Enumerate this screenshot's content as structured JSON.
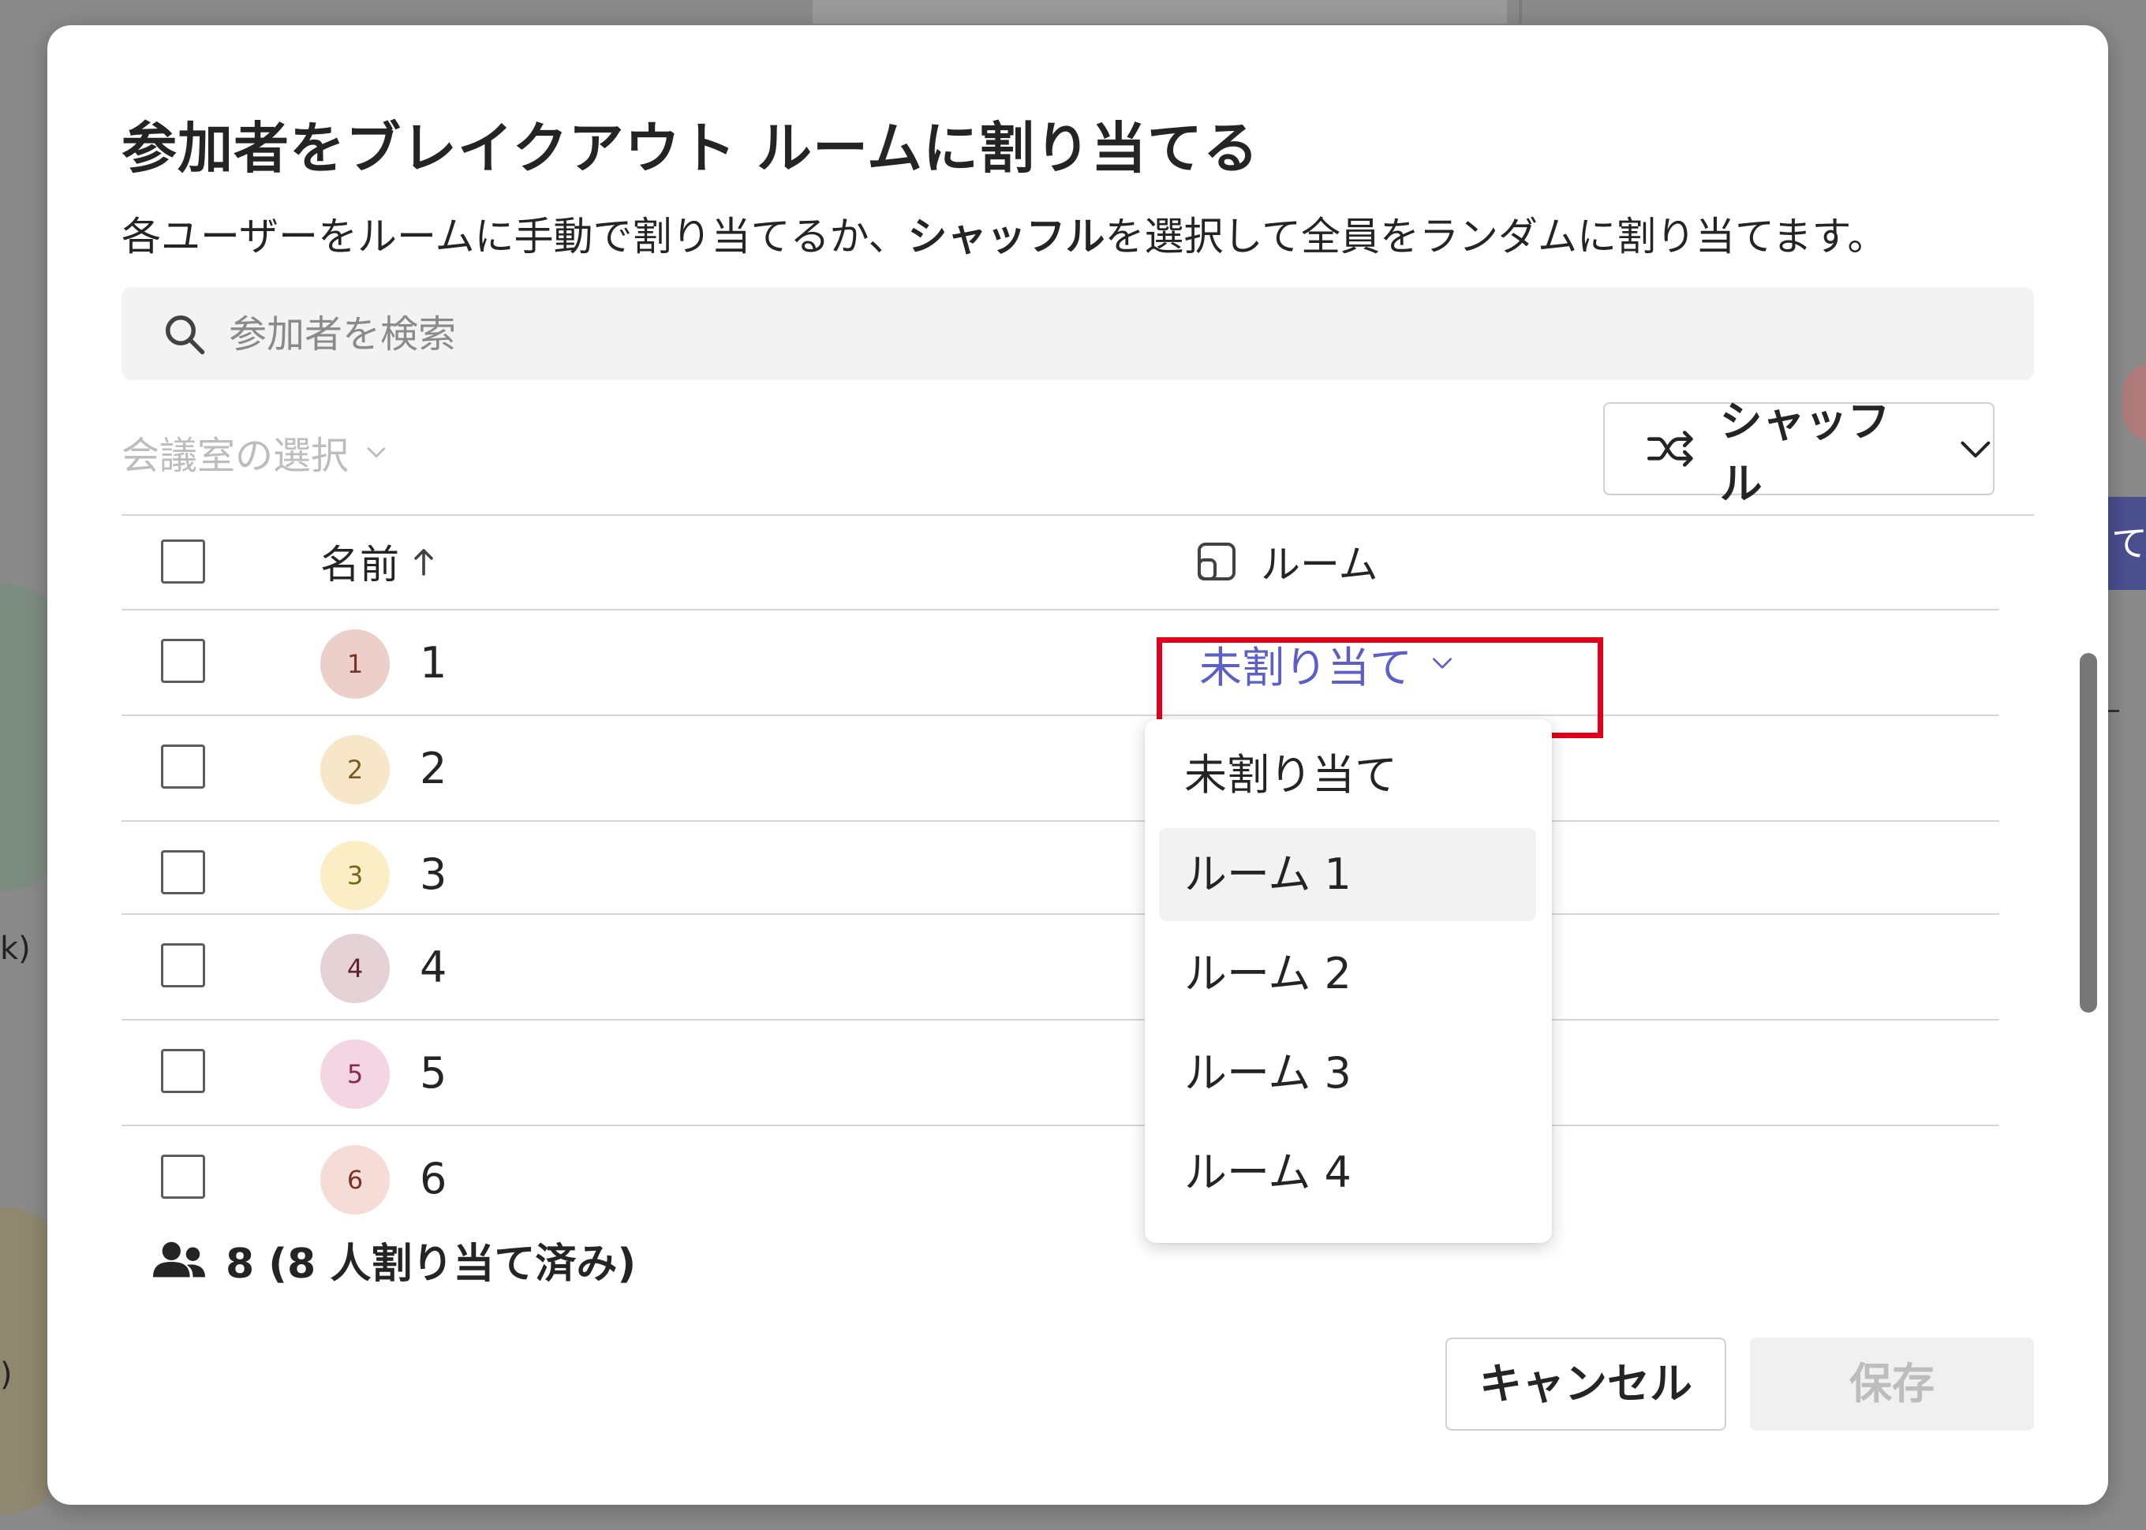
{
  "dialog": {
    "title": "参加者をブレイクアウト ルームに割り当てる",
    "description_prefix": "各ユーザーをルームに手動で割り当てるか、",
    "description_bold": "シャッフル",
    "description_suffix": "を選択して全員をランダムに割り当てます。"
  },
  "search": {
    "placeholder": "参加者を検索",
    "icon": "search-icon"
  },
  "room_select": {
    "label": "会議室の選択"
  },
  "shuffle": {
    "label": "シャッフル",
    "icon": "shuffle-icon"
  },
  "table": {
    "columns": {
      "name": "名前",
      "room": "ルーム"
    },
    "rows": [
      {
        "initial": "1",
        "name": "1",
        "avatar_bg": "#eccfc9",
        "avatar_fg": "#7b3328",
        "room": "未割り当て"
      },
      {
        "initial": "2",
        "name": "2",
        "avatar_bg": "#f7e6c8",
        "avatar_fg": "#7a5b20"
      },
      {
        "initial": "3",
        "name": "3",
        "avatar_bg": "#fbeec4",
        "avatar_fg": "#7a6217"
      },
      {
        "initial": "4",
        "name": "4",
        "avatar_bg": "#e4d2d6",
        "avatar_fg": "#5e2231"
      },
      {
        "initial": "5",
        "name": "5",
        "avatar_bg": "#f3d6e1",
        "avatar_fg": "#8a2850"
      },
      {
        "initial": "6",
        "name": "6",
        "avatar_bg": "#f6dcd7",
        "avatar_fg": "#7b3328"
      }
    ]
  },
  "room_menu": {
    "items": [
      "未割り当て",
      "ルーム 1",
      "ルーム 2",
      "ルーム 3",
      "ルーム 4"
    ],
    "hovered_index": 1
  },
  "footer": {
    "count": "8 (8 人割り当て済み)",
    "cancel": "キャンセル",
    "save": "保存"
  },
  "background": {
    "left_text": "k)",
    "left_text2": ")",
    "right_chip": "て"
  },
  "colors": {
    "accent": "#5b5fc7",
    "highlight": "#e0001b"
  }
}
